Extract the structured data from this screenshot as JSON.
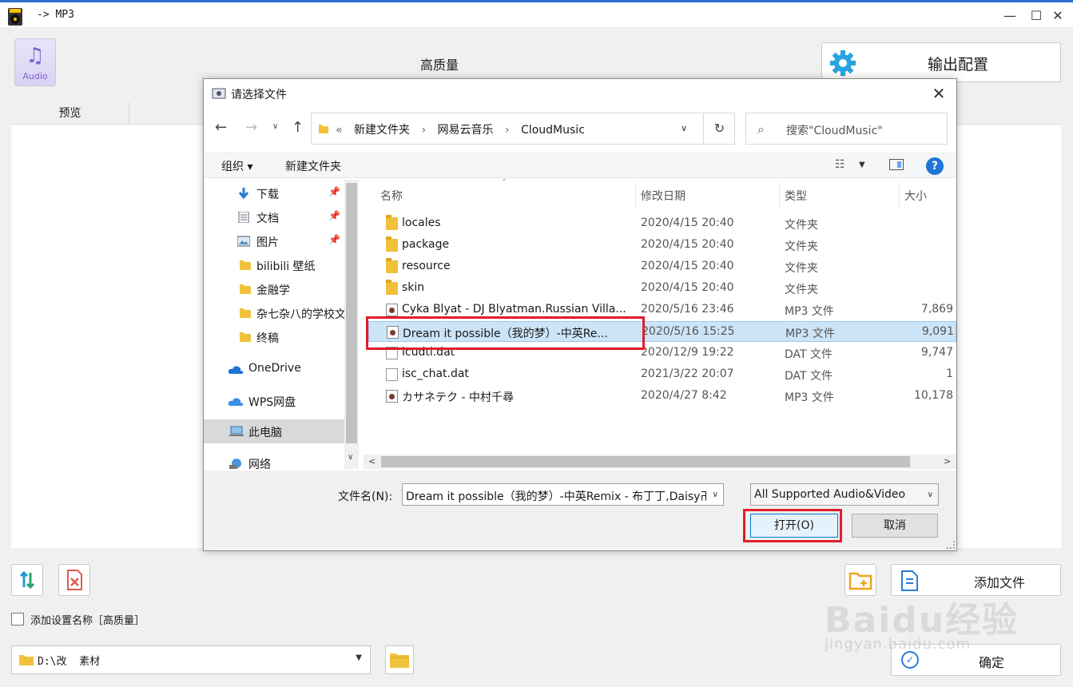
{
  "app": {
    "title": "-> MP3",
    "audio_tile_label": "Audio",
    "quality_title": "高质量",
    "output_config_label": "输出配置",
    "preview_tab": "预览",
    "add_file_label": "添加文件",
    "checkbox_label": "添加设置名称［高质量］",
    "output_path": "D:\\改  素材",
    "ok_label": "确定",
    "watermark": "Baidu经验",
    "watermark_sub": "jingyan.baidu.com"
  },
  "dialog": {
    "title": "请选择文件",
    "breadcrumbs": [
      "«",
      "新建文件夹",
      "›",
      "网易云音乐",
      "›",
      "CloudMusic"
    ],
    "search_placeholder": "搜索\"CloudMusic\"",
    "toolbar": {
      "organize": "组织 ▾",
      "new_folder": "新建文件夹"
    },
    "nav_items": [
      {
        "label": "下载",
        "icon": "download-icon",
        "pinned": true
      },
      {
        "label": "文档",
        "icon": "document-icon",
        "pinned": true
      },
      {
        "label": "图片",
        "icon": "picture-icon",
        "pinned": true
      },
      {
        "label": "bilibili 壁纸",
        "icon": "folder-icon",
        "pinned": false
      },
      {
        "label": "金融学",
        "icon": "folder-icon",
        "pinned": false
      },
      {
        "label": "杂七杂八的学校文",
        "icon": "folder-icon",
        "pinned": false
      },
      {
        "label": "终稿",
        "icon": "folder-icon",
        "pinned": false
      },
      {
        "label": "OneDrive",
        "icon": "cloud-icon",
        "pinned": false
      },
      {
        "label": "WPS网盘",
        "icon": "cloud-icon",
        "pinned": false
      },
      {
        "label": "此电脑",
        "icon": "computer-icon",
        "pinned": false
      },
      {
        "label": "网络",
        "icon": "network-icon",
        "pinned": false
      }
    ],
    "columns": [
      "名称",
      "修改日期",
      "类型",
      "大小"
    ],
    "files": [
      {
        "name": "locales",
        "date": "2020/4/15 20:40",
        "type": "文件夹",
        "size": "",
        "icon": "folder"
      },
      {
        "name": "package",
        "date": "2020/4/15 20:40",
        "type": "文件夹",
        "size": "",
        "icon": "folder"
      },
      {
        "name": "resource",
        "date": "2020/4/15 20:40",
        "type": "文件夹",
        "size": "",
        "icon": "folder"
      },
      {
        "name": "skin",
        "date": "2020/4/15 20:40",
        "type": "文件夹",
        "size": "",
        "icon": "folder"
      },
      {
        "name": "Cyka Blyat - DJ Blyatman.Russian Villa...",
        "date": "2020/5/16 23:46",
        "type": "MP3 文件",
        "size": "7,869",
        "icon": "mp3"
      },
      {
        "name": "Dream it possible（我的梦）-中英Re...",
        "date": "2020/5/16 15:25",
        "type": "MP3 文件",
        "size": "9,091",
        "icon": "mp3",
        "selected": true
      },
      {
        "name": "icudtl.dat",
        "date": "2020/12/9 19:22",
        "type": "DAT 文件",
        "size": "9,747",
        "icon": "dat"
      },
      {
        "name": "isc_chat.dat",
        "date": "2021/3/22 20:07",
        "type": "DAT 文件",
        "size": "1",
        "icon": "dat"
      },
      {
        "name": "カサネテク - 中村千尋",
        "date": "2020/4/27 8:42",
        "type": "MP3 文件",
        "size": "10,178",
        "icon": "mp3"
      }
    ],
    "filename_label": "文件名(N):",
    "filename_value": "Dream it possible（我的梦）-中英Remix - 布丁丁,Daisy卍",
    "filetype_value": "All Supported Audio&Video",
    "open_label": "打开(O)",
    "cancel_label": "取消"
  },
  "colors": {
    "accent": "#0078d7",
    "selection": "#cce4f7",
    "annotation": "#e01d2a"
  }
}
